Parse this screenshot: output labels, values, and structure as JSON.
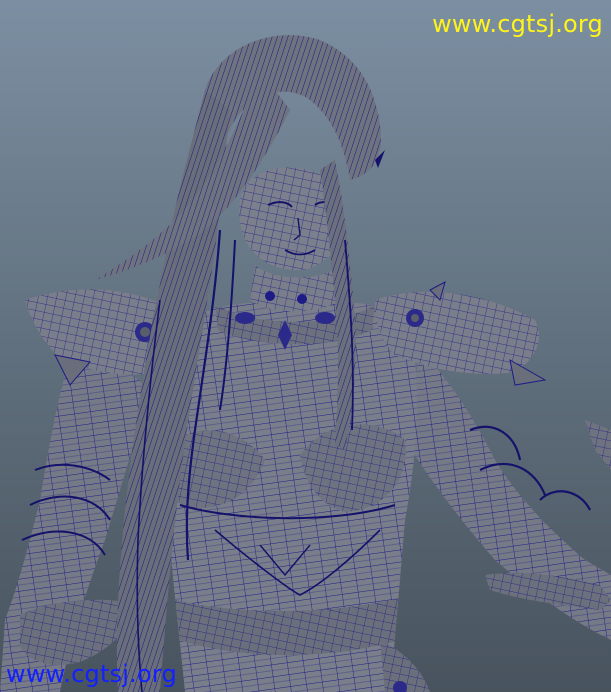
{
  "viewport": {
    "background_top": "#7c8fa2",
    "background_bottom": "#48535e",
    "mesh_fill": "#737783",
    "wire_color": "#1d1b86",
    "wire_dark": "#14126a"
  },
  "watermarks": {
    "top": {
      "text": "www.cgtsj.org",
      "color": "#fff41a"
    },
    "bottom": {
      "text": "www.cgtsj.org",
      "color": "#1320ff"
    }
  }
}
